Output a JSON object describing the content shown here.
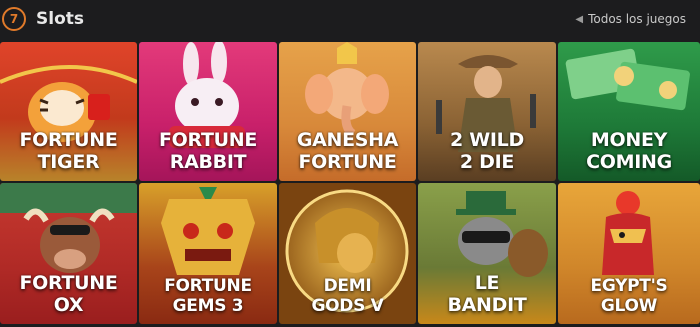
{
  "header": {
    "logo_text": "7",
    "title": "Slots",
    "all_games_label": "Todos los juegos",
    "all_games_icon": "chevron-left-icon"
  },
  "colors": {
    "accent": "#e07a2a",
    "background": "#1c1c1e"
  },
  "games": [
    {
      "label": "FORTUNE\nTIGER"
    },
    {
      "label": "FORTUNE\nRABBIT"
    },
    {
      "label": "GANESHA\nFORTUNE"
    },
    {
      "label": "2 WILD\n2 DIE"
    },
    {
      "label": "MONEY\nCOMING"
    },
    {
      "label": "FORTUNE\nOX"
    },
    {
      "label": "FORTUNE\nGEMS 3"
    },
    {
      "label": "DEMI\nGODS V"
    },
    {
      "label": "LE\nBANDIT"
    },
    {
      "label": "EGYPT'S\nGLOW"
    }
  ]
}
